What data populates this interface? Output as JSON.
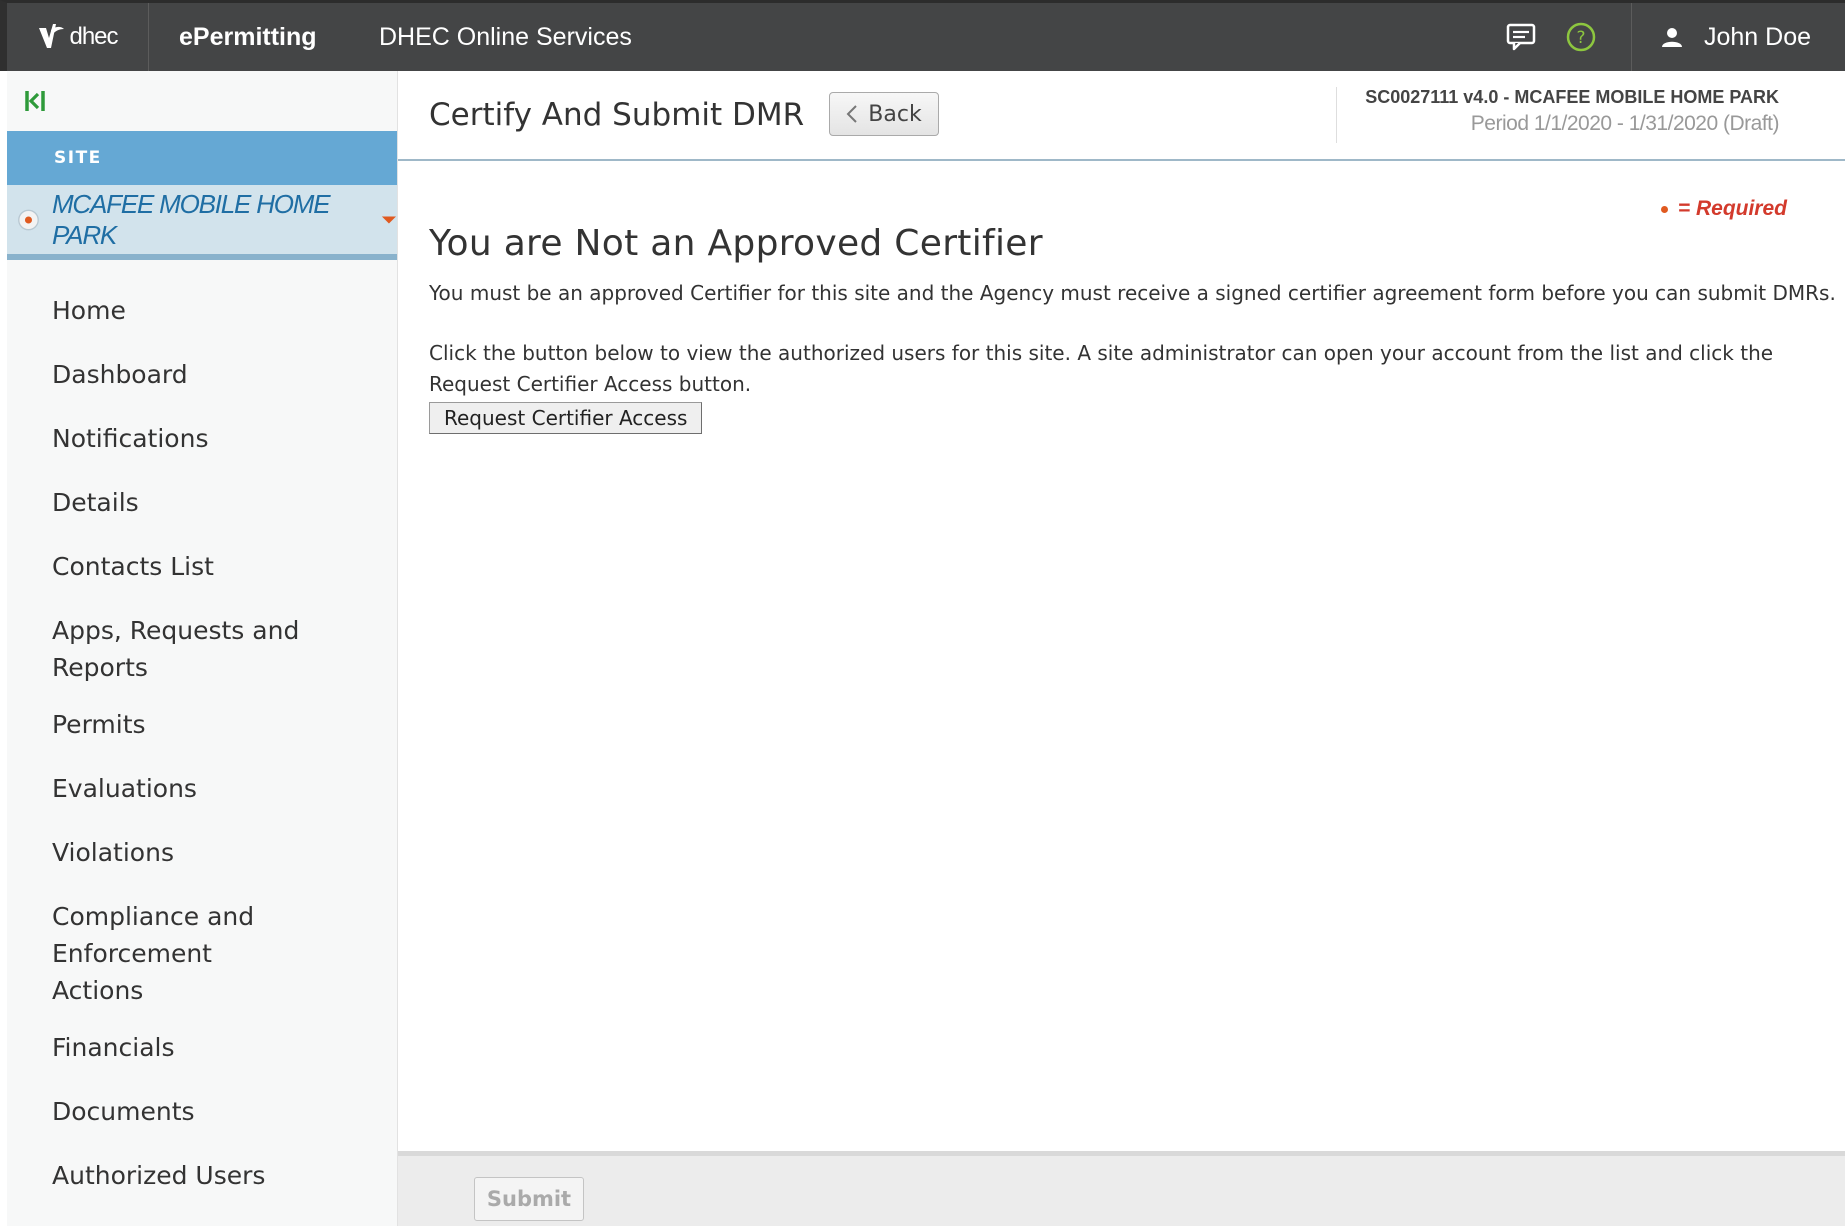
{
  "topbar": {
    "logo_text": "dhec",
    "app_name": "ePermitting",
    "service_name": "DHEC Online Services",
    "user_name": "John Doe",
    "icons": [
      "chat-icon",
      "help-icon",
      "user-icon"
    ],
    "help_color": "#8dc63f"
  },
  "sidebar": {
    "section_label": "SITE",
    "site_name": "MCAFEE MOBILE HOME PARK",
    "nav": [
      {
        "label": "Home"
      },
      {
        "label": "Dashboard"
      },
      {
        "label": "Notifications"
      },
      {
        "label": "Details"
      },
      {
        "label": "Contacts List"
      },
      {
        "label": "Apps, Requests and Reports"
      },
      {
        "label": "Permits"
      },
      {
        "label": "Evaluations"
      },
      {
        "label": "Violations"
      },
      {
        "label": "Compliance and Enforcement Actions"
      },
      {
        "label": "Financials"
      },
      {
        "label": "Documents"
      },
      {
        "label": "Authorized Users"
      }
    ]
  },
  "header": {
    "title": "Certify And Submit DMR",
    "back_label": "Back",
    "permit_line": "SC0027111 v4.0 - MCAFEE MOBILE HOME PARK",
    "period_line": "Period 1/1/2020 - 1/31/2020 (Draft)"
  },
  "content": {
    "required_label": "= Required",
    "heading": "You are Not an Approved Certifier",
    "paragraph1": "You must be an approved Certifier for this site and the Agency must receive a signed certifier agreement form before you can submit DMRs.",
    "paragraph2": "Click the button below to view the authorized users for this site. A site administrator can open your account from the list and click the Request Certifier Access button.",
    "request_button": "Request Certifier Access"
  },
  "footer": {
    "submit_label": "Submit"
  },
  "colors": {
    "topbar": "#444546",
    "site_header": "#65a8d4",
    "site_selector": "#d2e3ec",
    "site_name": "#1f6ea4",
    "accent_orange": "#e05a20",
    "required_red": "#d33a2c"
  }
}
